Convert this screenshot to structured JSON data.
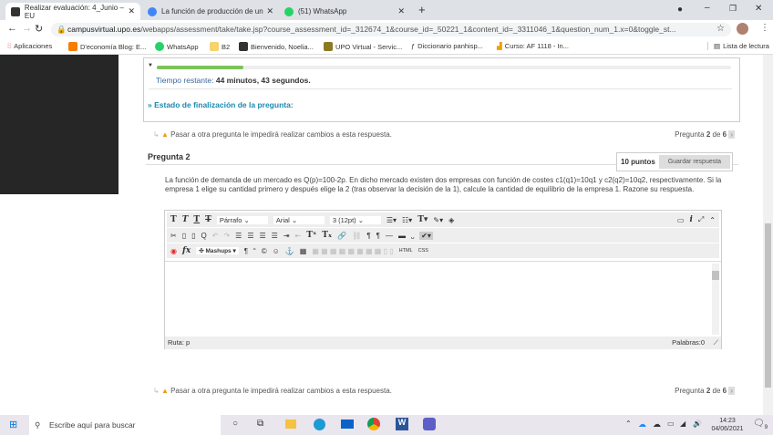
{
  "browser": {
    "tabs": [
      {
        "title": "Realizar evaluación: 4_Junio – EU"
      },
      {
        "title": "La función de producción de un"
      },
      {
        "title": "(51) WhatsApp"
      }
    ],
    "url_host": "campusvirtual.upo.es",
    "url_path": "/webapps/assessment/take/take.jsp?course_assessment_id=_312674_1&course_id=_50221_1&content_id=_3311046_1&question_num_1.x=0&toggle_st...",
    "bookmarks": [
      "Aplicaciones",
      "D'economía Blog: E...",
      "WhatsApp",
      "B2",
      "Bienvenido, Noelia...",
      "UPO Virtual - Servic...",
      "Diccionario panhisp...",
      "Curso: AF 1118 - In..."
    ],
    "reading_list": "Lista de lectura"
  },
  "timer": {
    "label": "Tiempo restante:",
    "value": "44 minutos, 43 segundos.",
    "progress_percent": 15
  },
  "status_label": "Estado de finalización de la pregunta:",
  "warning": "Pasar a otra pregunta le impedirá realizar cambios a esta respuesta.",
  "pager": {
    "prefix": "Pregunta",
    "current": "2",
    "of": "de",
    "total": "6"
  },
  "question": {
    "title": "Pregunta 2",
    "points": "10 puntos",
    "save": "Guardar respuesta",
    "text": "La función de demanda de un mercado es Q(p)=100-2p. En dicho mercado existen dos empresas con función de costes c1(q1)=10q1 y c2(q2)=10q2, respectivamente. Si la empresa 1 elige su cantidad primero y después elige la 2 (tras observar la decisión de la 1), calcule la cantidad de equilibrio de la empresa 1. Razone su respuesta."
  },
  "editor": {
    "format": "Párrafo",
    "font": "Arial",
    "size": "3 (12pt)",
    "mashups": "Mashups",
    "path": "Ruta: p",
    "words": "Palabras:0"
  },
  "taskbar": {
    "search": "Escribe aquí para buscar",
    "time": "14:23",
    "date": "04/06/2021",
    "notifications": "9"
  }
}
